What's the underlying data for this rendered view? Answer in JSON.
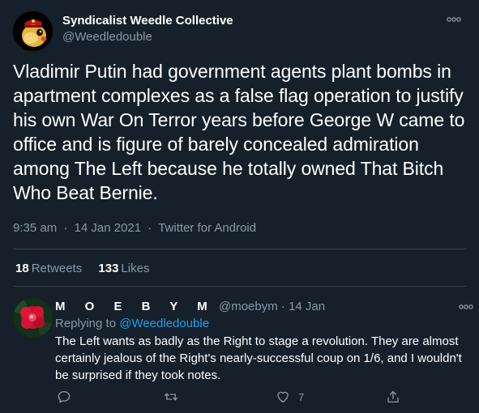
{
  "main_tweet": {
    "display_name": "Syndicalist Weedle Collective",
    "handle": "@Weedledouble",
    "text": "Vladimir Putin had government agents plant bombs in apartment complexes as a false flag operation to justify his own War On Terror years before George W came to office and is figure of barely concealed admiration among The Left because he totally owned That Bitch Who Beat Bernie.",
    "time": "9:35 am",
    "date": "14 Jan 2021",
    "separator": "·",
    "source": "Twitter for Android"
  },
  "stats": {
    "retweets_count": "18",
    "retweets_label": "Retweets",
    "likes_count": "133",
    "likes_label": "Likes"
  },
  "reply": {
    "display_name": "M O E B Y M",
    "handle": "@moebym",
    "separator": "·",
    "date": "14 Jan",
    "replying_prefix": "Replying to",
    "replying_to": "@Weedledouble",
    "text": "The Left wants as badly as the Right to stage a revolution. They are almost certainly jealous of the Right's nearly-successful coup on 1/6, and I wouldn't be surprised if they took notes.",
    "like_count": "7"
  },
  "icons": {
    "more": "more-dots-icon",
    "reply": "reply-bubble-icon",
    "retweet": "retweet-icon",
    "like": "heart-icon",
    "share": "share-icon"
  },
  "colors": {
    "background": "#15202b",
    "text": "#ffffff",
    "secondary_text": "#8899a6",
    "link": "#1da1f2",
    "divider": "#38444d"
  }
}
